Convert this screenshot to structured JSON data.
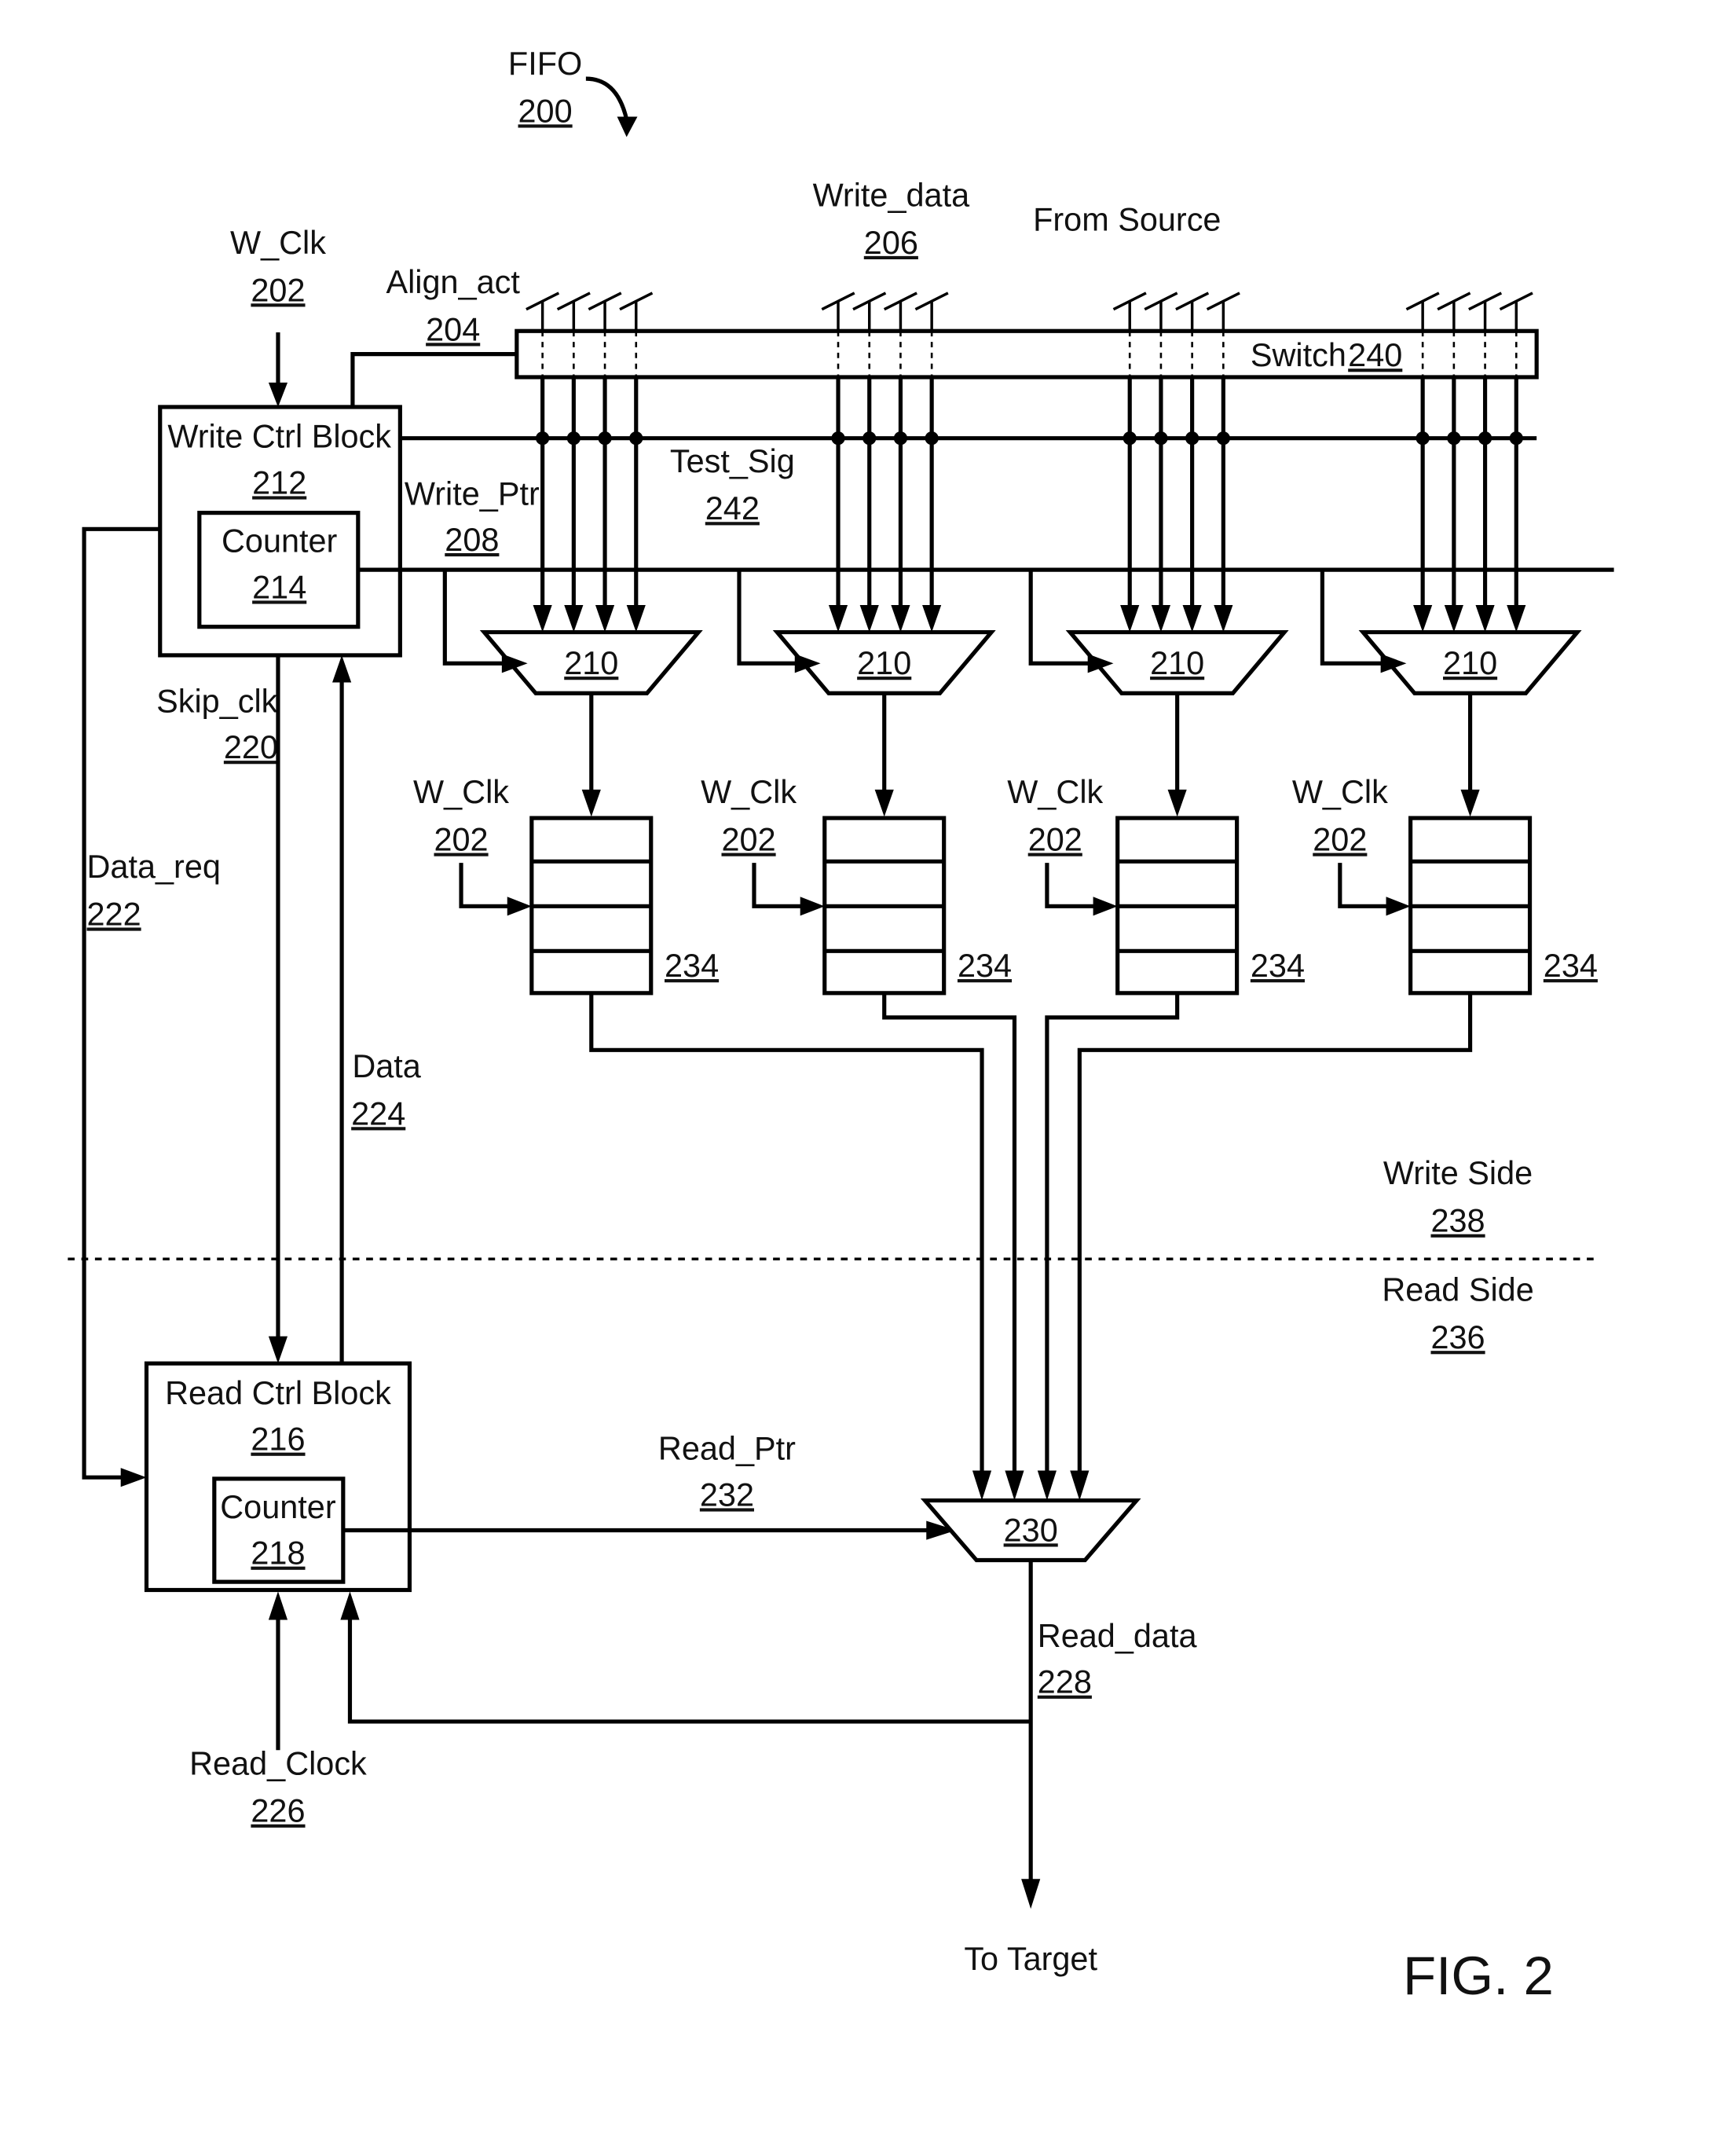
{
  "figure": {
    "title": "FIFO",
    "ref": "200",
    "caption": "FIG. 2"
  },
  "labels": {
    "w_clk": {
      "name": "W_Clk",
      "ref": "202"
    },
    "align_act": {
      "name": "Align_act",
      "ref": "204"
    },
    "write_data": {
      "name": "Write_data",
      "ref": "206"
    },
    "from_source": "From Source",
    "switch": {
      "name": "Switch",
      "ref": "240"
    },
    "write_ctrl": {
      "name": "Write Ctrl Block",
      "ref": "212"
    },
    "counter_w": {
      "name": "Counter",
      "ref": "214"
    },
    "write_ptr": {
      "name": "Write_Ptr",
      "ref": "208"
    },
    "test_sig": {
      "name": "Test_Sig",
      "ref": "242"
    },
    "mux_w": "210",
    "register": "234",
    "skip_clk": {
      "name": "Skip_clk",
      "ref": "220"
    },
    "data_req": {
      "name": "Data_req",
      "ref": "222"
    },
    "data": {
      "name": "Data",
      "ref": "224"
    },
    "write_side": {
      "name": "Write Side",
      "ref": "238"
    },
    "read_side": {
      "name": "Read Side",
      "ref": "236"
    },
    "read_ctrl": {
      "name": "Read Ctrl Block",
      "ref": "216"
    },
    "counter_r": {
      "name": "Counter",
      "ref": "218"
    },
    "read_ptr": {
      "name": "Read_Ptr",
      "ref": "232"
    },
    "mux_r": "230",
    "read_data": {
      "name": "Read_data",
      "ref": "228"
    },
    "read_clock": {
      "name": "Read_Clock",
      "ref": "226"
    },
    "to_target": "To Target"
  },
  "lanes": [
    {
      "id": 1
    },
    {
      "id": 2
    },
    {
      "id": 3
    },
    {
      "id": 4
    }
  ]
}
